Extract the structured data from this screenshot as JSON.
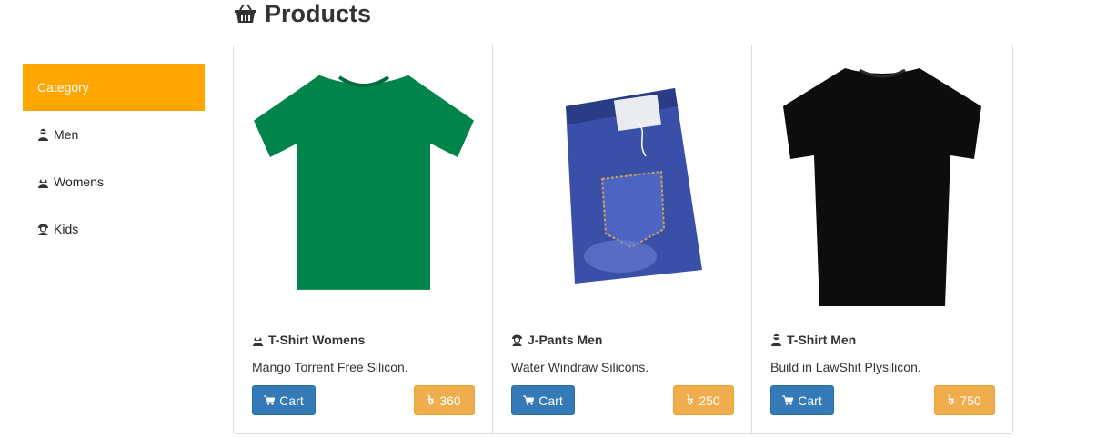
{
  "header": {
    "title": "Products",
    "icon": "basket-icon"
  },
  "sidebar": {
    "header": "Category",
    "items": [
      {
        "label": "Men",
        "icon": "man-icon"
      },
      {
        "label": "Womens",
        "icon": "woman-icon"
      },
      {
        "label": "Kids",
        "icon": "kid-icon"
      }
    ]
  },
  "products": [
    {
      "title": "T-Shirt Womens",
      "icon": "woman-icon",
      "description": "Mango Torrent Free Silicon.",
      "cart_label": "Cart",
      "currency_symbol": "৳",
      "price": "360",
      "image": "green-tshirt"
    },
    {
      "title": "J-Pants Men",
      "icon": "kid-icon",
      "description": "Water Windraw Silicons.",
      "cart_label": "Cart",
      "currency_symbol": "৳",
      "price": "250",
      "image": "blue-jeans"
    },
    {
      "title": "T-Shirt Men",
      "icon": "man-icon",
      "description": "Build in LawShit Plysilicon.",
      "cart_label": "Cart",
      "currency_symbol": "৳",
      "price": "750",
      "image": "black-tshirt"
    }
  ],
  "colors": {
    "category_header": "#ffa600",
    "cart_button": "#337ab7",
    "price_button": "#f0ad4e"
  }
}
